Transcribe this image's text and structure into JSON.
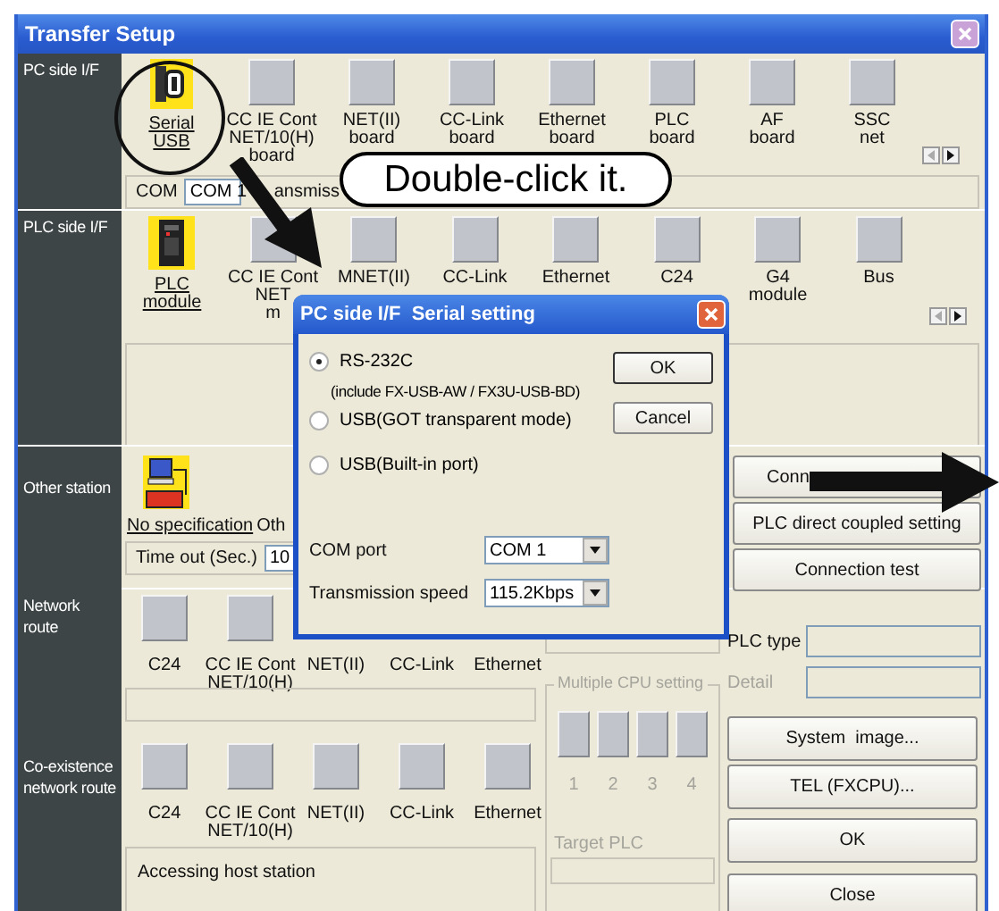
{
  "window": {
    "title": "Transfer Setup"
  },
  "pc_side": {
    "label": "PC side I/F",
    "items": [
      {
        "lines": [
          "Serial",
          "USB"
        ],
        "kind": "serial",
        "selected": true
      },
      {
        "lines": [
          "CC IE Cont",
          "NET/10(H)",
          "board"
        ],
        "kind": "blank",
        "selected": false
      },
      {
        "lines": [
          "NET(II)",
          "board"
        ],
        "kind": "blank",
        "selected": false
      },
      {
        "lines": [
          "CC-Link",
          "board"
        ],
        "kind": "blank",
        "selected": false
      },
      {
        "lines": [
          "Ethernet",
          "board"
        ],
        "kind": "blank",
        "selected": false
      },
      {
        "lines": [
          "PLC",
          "board"
        ],
        "kind": "blank",
        "selected": false
      },
      {
        "lines": [
          "AF",
          "board"
        ],
        "kind": "blank",
        "selected": false
      },
      {
        "lines": [
          "SSC",
          "net"
        ],
        "kind": "blank",
        "selected": false
      }
    ],
    "com_label": "COM",
    "com_value": "COM 1",
    "covered_text": "ansmiss"
  },
  "plc_side": {
    "label": "PLC side I/F",
    "items": [
      {
        "lines": [
          "PLC",
          "module"
        ],
        "kind": "plc",
        "selected": true
      },
      {
        "lines": [
          "CC IE Cont",
          "NET",
          "m"
        ],
        "kind": "blank",
        "selected": false
      },
      {
        "lines": [
          "MNET(II)"
        ],
        "kind": "blank",
        "selected": false
      },
      {
        "lines": [
          "CC-Link"
        ],
        "kind": "blank",
        "selected": false
      },
      {
        "lines": [
          "Ethernet"
        ],
        "kind": "blank",
        "selected": false
      },
      {
        "lines": [
          "C24"
        ],
        "kind": "blank",
        "selected": false
      },
      {
        "lines": [
          "G4",
          "module"
        ],
        "kind": "blank",
        "selected": false
      },
      {
        "lines": [
          "Bus"
        ],
        "kind": "blank",
        "selected": false
      }
    ]
  },
  "other_station": {
    "label": "Other station",
    "option": "No specification",
    "covered_text": "Oth",
    "timeout_label": "Time out (Sec.)",
    "timeout_value": "10",
    "buttons": [
      "Conn",
      "PLC direct coupled setting",
      "Connection test"
    ]
  },
  "network_route": {
    "label": "Network route",
    "items": [
      {
        "lines": [
          "C24"
        ],
        "kind": "blank"
      },
      {
        "lines": [
          "CC IE Cont",
          "NET/10(H)"
        ],
        "kind": "blank"
      },
      {
        "lines": [
          "NET(II)"
        ],
        "kind": "none"
      },
      {
        "lines": [
          "CC-Link"
        ],
        "kind": "none"
      },
      {
        "lines": [
          "Ethernet"
        ],
        "kind": "none"
      }
    ]
  },
  "coexistence_route": {
    "label": "Co-existence network route",
    "items": [
      {
        "lines": [
          "C24"
        ],
        "kind": "blank"
      },
      {
        "lines": [
          "CC IE Cont",
          "NET/10(H)"
        ],
        "kind": "blank"
      },
      {
        "lines": [
          "NET(II)"
        ],
        "kind": "blank"
      },
      {
        "lines": [
          "CC-Link"
        ],
        "kind": "blank"
      },
      {
        "lines": [
          "Ethernet"
        ],
        "kind": "blank"
      }
    ],
    "status": "Accessing host station"
  },
  "multiple_cpu": {
    "legend": "Multiple CPU setting",
    "disabled": true,
    "slots": [
      "1",
      "2",
      "3",
      "4"
    ],
    "target_label": "Target PLC"
  },
  "plc_type": {
    "label": "PLC type",
    "disabled": false
  },
  "detail": {
    "label": "Detail",
    "disabled": true
  },
  "side_buttons": [
    "System  image...",
    "TEL (FXCPU)...",
    "OK",
    "Close"
  ],
  "dialog": {
    "title": "PC side I/F  Serial setting",
    "options": [
      {
        "label": "RS-232C",
        "note": "(include FX-USB-AW / FX3U-USB-BD)",
        "selected": true
      },
      {
        "label": "USB(GOT transparent mode)",
        "selected": false
      },
      {
        "label": "USB(Built-in port)",
        "selected": false
      }
    ],
    "buttons": [
      "OK",
      "Cancel"
    ],
    "fields": [
      {
        "label": "COM port",
        "value": "COM 1"
      },
      {
        "label": "Transmission speed",
        "value": "115.2Kbps"
      }
    ]
  },
  "callout": "Double-click it."
}
